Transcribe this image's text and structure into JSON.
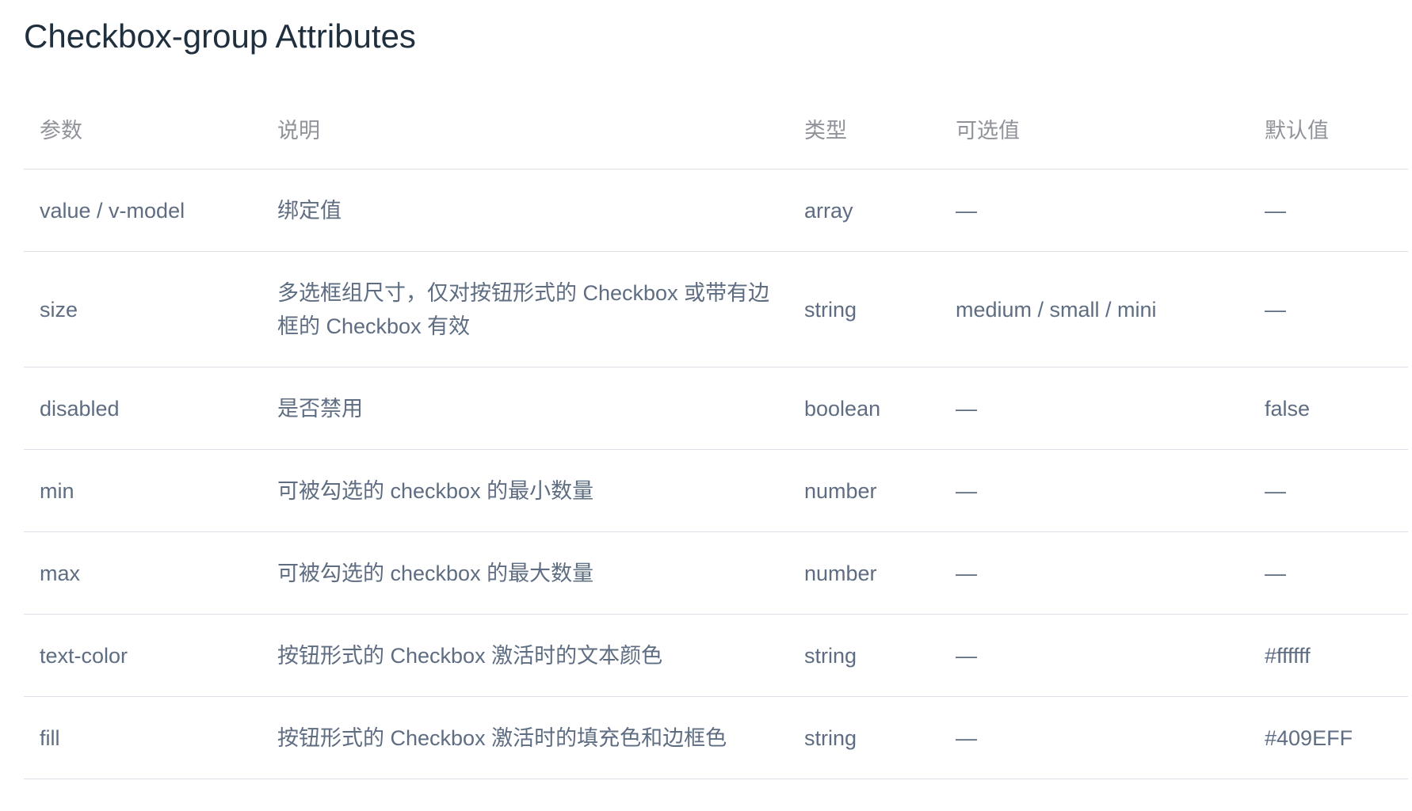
{
  "title": "Checkbox-group Attributes",
  "table": {
    "headers": [
      "参数",
      "说明",
      "类型",
      "可选值",
      "默认值"
    ],
    "rows": [
      [
        "value / v-model",
        "绑定值",
        "array",
        "—",
        "—"
      ],
      [
        "size",
        "多选框组尺寸，仅对按钮形式的 Checkbox 或带有边框的 Checkbox 有效",
        "string",
        "medium / small / mini",
        "—"
      ],
      [
        "disabled",
        "是否禁用",
        "boolean",
        "—",
        "false"
      ],
      [
        "min",
        "可被勾选的 checkbox 的最小数量",
        "number",
        "—",
        "—"
      ],
      [
        "max",
        "可被勾选的 checkbox 的最大数量",
        "number",
        "—",
        "—"
      ],
      [
        "text-color",
        "按钮形式的 Checkbox 激活时的文本颜色",
        "string",
        "—",
        "#ffffff"
      ],
      [
        "fill",
        "按钮形式的 Checkbox 激活时的填充色和边框色",
        "string",
        "—",
        "#409EFF"
      ]
    ]
  },
  "colors": {
    "title": "#1f2f3d",
    "header_text": "#909399",
    "cell_text": "#5e6d82",
    "border": "#dcdfe6"
  }
}
